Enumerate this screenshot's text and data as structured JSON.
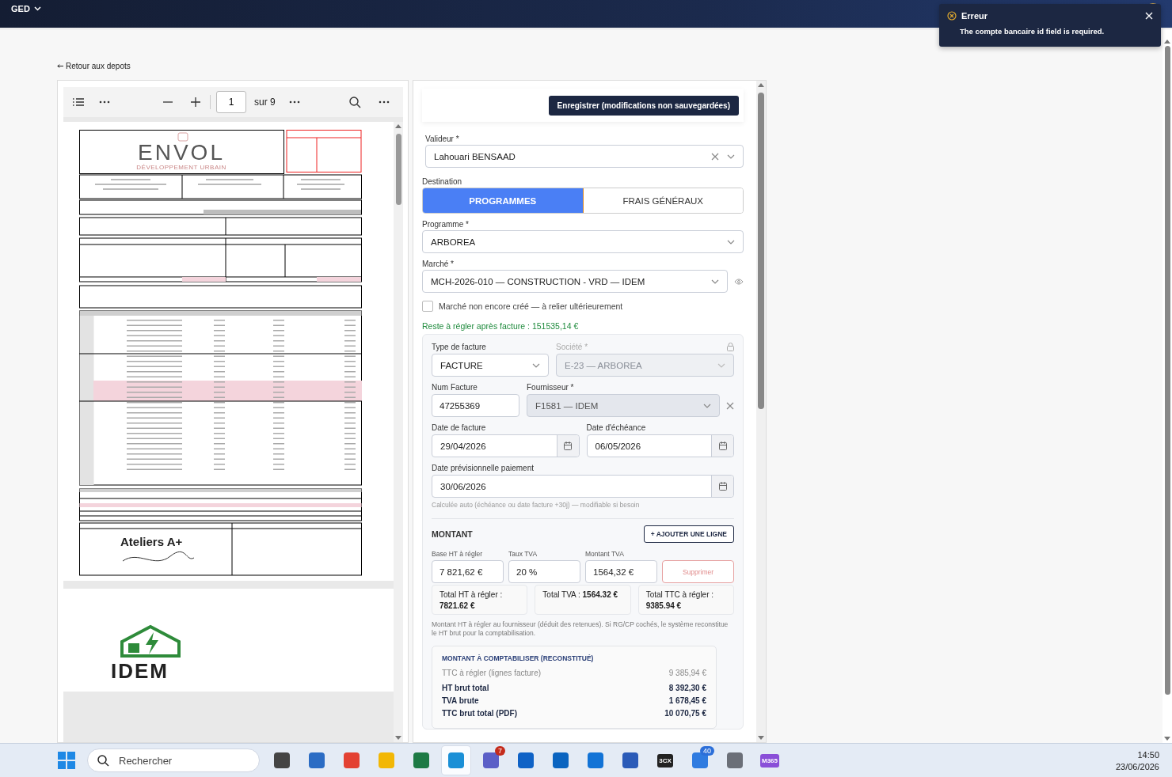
{
  "app_bar": {
    "menu": "GED"
  },
  "toast": {
    "title": "Erreur",
    "message": "The compte bancaire id field is required."
  },
  "back_link": "Retour aux depots",
  "viewer": {
    "page": "1",
    "total": "sur 9",
    "logo_top": "ENVOL",
    "logo_sub": "DÉVELOPPEMENT URBAIN",
    "signature_logo": "Ateliers A+",
    "page2_logo": "IDEM"
  },
  "save_button": "Enregistrer (modifications non sauvegardées)",
  "valideur": {
    "label": "Valideur *",
    "value": "Lahouari BENSAAD"
  },
  "destination": {
    "label": "Destination",
    "options": [
      {
        "label": "PROGRAMMES",
        "selected": true
      },
      {
        "label": "FRAIS GÉNÉRAUX",
        "selected": false
      }
    ]
  },
  "programme": {
    "label": "Programme *",
    "value": "ARBOREA"
  },
  "marche": {
    "label": "Marché *",
    "value": "MCH-2026-010 — CONSTRUCTION - VRD — IDEM"
  },
  "marche_pending": {
    "label": "Marché non encore créé — à relier ultérieurement",
    "checked": false
  },
  "reste": "Reste à régler après facture : 151535,14 €",
  "invoice": {
    "type": {
      "label": "Type de facture",
      "value": "FACTURE",
      "disabled": false
    },
    "societe": {
      "label": "Société *",
      "value": "E-23 — ARBOREA",
      "disabled": true
    },
    "num": {
      "label": "Num Facture",
      "value": "47255369"
    },
    "fournisseur": {
      "label": "Fournisseur *",
      "value": "F1581 — IDEM",
      "disabled": true
    },
    "date_facture": {
      "label": "Date de facture",
      "value": "29/04/2026"
    },
    "date_echeance": {
      "label": "Date d'échéance",
      "value": "06/05/2026"
    },
    "date_paiement": {
      "label": "Date prévisionnelle paiement",
      "value": "30/06/2026"
    },
    "hint": "Calculée auto (échéance ou date facture +30j) — modifiable si besoin"
  },
  "montant": {
    "title": "MONTANT",
    "add_button": "+ AJOUTER UNE LIGNE",
    "line": {
      "base_label": "Base HT à régler",
      "base": "7 821,62 €",
      "taux_label": "Taux TVA",
      "taux": "20 %",
      "tva_label": "Montant TVA",
      "tva": "1564,32 €",
      "delete": "Supprimer"
    },
    "totals": [
      "Total HT à régler : **7821.62 €**",
      "Total TVA : **1564.32 €**",
      "Total TTC à régler : **9385.94 €**"
    ],
    "note": "Montant HT à régler au fournisseur (déduit des retenues). Si RG/CP cochés, le système reconstitue le HT brut pour la comptabilisation.",
    "comptabiliser": {
      "title": "MONTANT À COMPTABILISER (RECONSTITUÉ)",
      "rows": [
        {
          "kind": "muted",
          "label": "TTC à régler (lignes facture)",
          "value": "9 385,94 €"
        },
        {
          "kind": "bold",
          "label": "HT brut total",
          "value": "8 392,30 €"
        },
        {
          "kind": "bold",
          "label": "TVA brute",
          "value": "1 678,45 €"
        },
        {
          "kind": "bold",
          "label": "TTC brut total (PDF)",
          "value": "10 070,75 €"
        }
      ]
    }
  },
  "taskbar": {
    "search_placeholder": "Rechercher",
    "apps": [
      {
        "selected": false
      },
      {
        "selected": false
      },
      {
        "selected": false
      },
      {
        "selected": false
      },
      {
        "selected": false
      },
      {
        "selected": true
      },
      {
        "selected": false,
        "badge": "7"
      },
      {
        "selected": false
      },
      {
        "selected": false
      },
      {
        "selected": false
      },
      {
        "selected": false
      },
      {
        "selected": false,
        "label": "3CX"
      },
      {
        "selected": false,
        "badge": "40"
      },
      {
        "selected": false
      },
      {
        "selected": false,
        "label": "M365"
      }
    ],
    "time": "14:50",
    "date": "23/06/2026"
  }
}
